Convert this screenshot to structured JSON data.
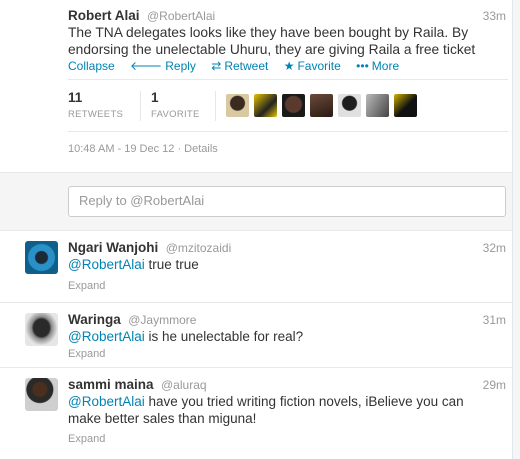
{
  "main_tweet": {
    "fullname": "Robert Alai",
    "username": "@RobertAlai",
    "time": "33m",
    "text": "The TNA delegates looks like they have been bought by Raila. By endorsing the unelectable Uhuru, they are giving Raila a free ticket",
    "actions": {
      "collapse": "Collapse",
      "reply": "Reply",
      "retweet": "Retweet",
      "favorite": "Favorite",
      "more": "More"
    },
    "stats": {
      "retweets_count": "11",
      "retweets_label": "RETWEETS",
      "favorites_count": "1",
      "favorites_label": "FAVORITE"
    },
    "datetime": "10:48 AM - 19 Dec 12 · Details"
  },
  "reply_box": {
    "placeholder": "Reply to @RobertAlai"
  },
  "replies": [
    {
      "fullname": "Ngari Wanjohi",
      "username": "@mzitozaidi",
      "time": "32m",
      "mention": "@RobertAlai",
      "text": " true true",
      "expand": "Expand"
    },
    {
      "fullname": "Waringa",
      "username": "@Jaymmore",
      "time": "31m",
      "mention": "@RobertAlai",
      "text": " is he unelectable for real?",
      "expand": "Expand"
    },
    {
      "fullname": "sammi maina",
      "username": "@aluraq",
      "time": "29m",
      "mention": "@RobertAlai",
      "text": " have you tried writing fiction novels, iBelieve you can make better sales than miguna!",
      "expand": "Expand"
    }
  ],
  "colors": {
    "link": "#0084b4",
    "muted": "#999999",
    "divider": "#e8e8e8",
    "reply_bg": "#f5f5f5"
  },
  "icons": {
    "reply": "reply-arrow-icon",
    "retweet": "retweet-icon",
    "favorite": "star-icon",
    "more": "dots-icon"
  }
}
